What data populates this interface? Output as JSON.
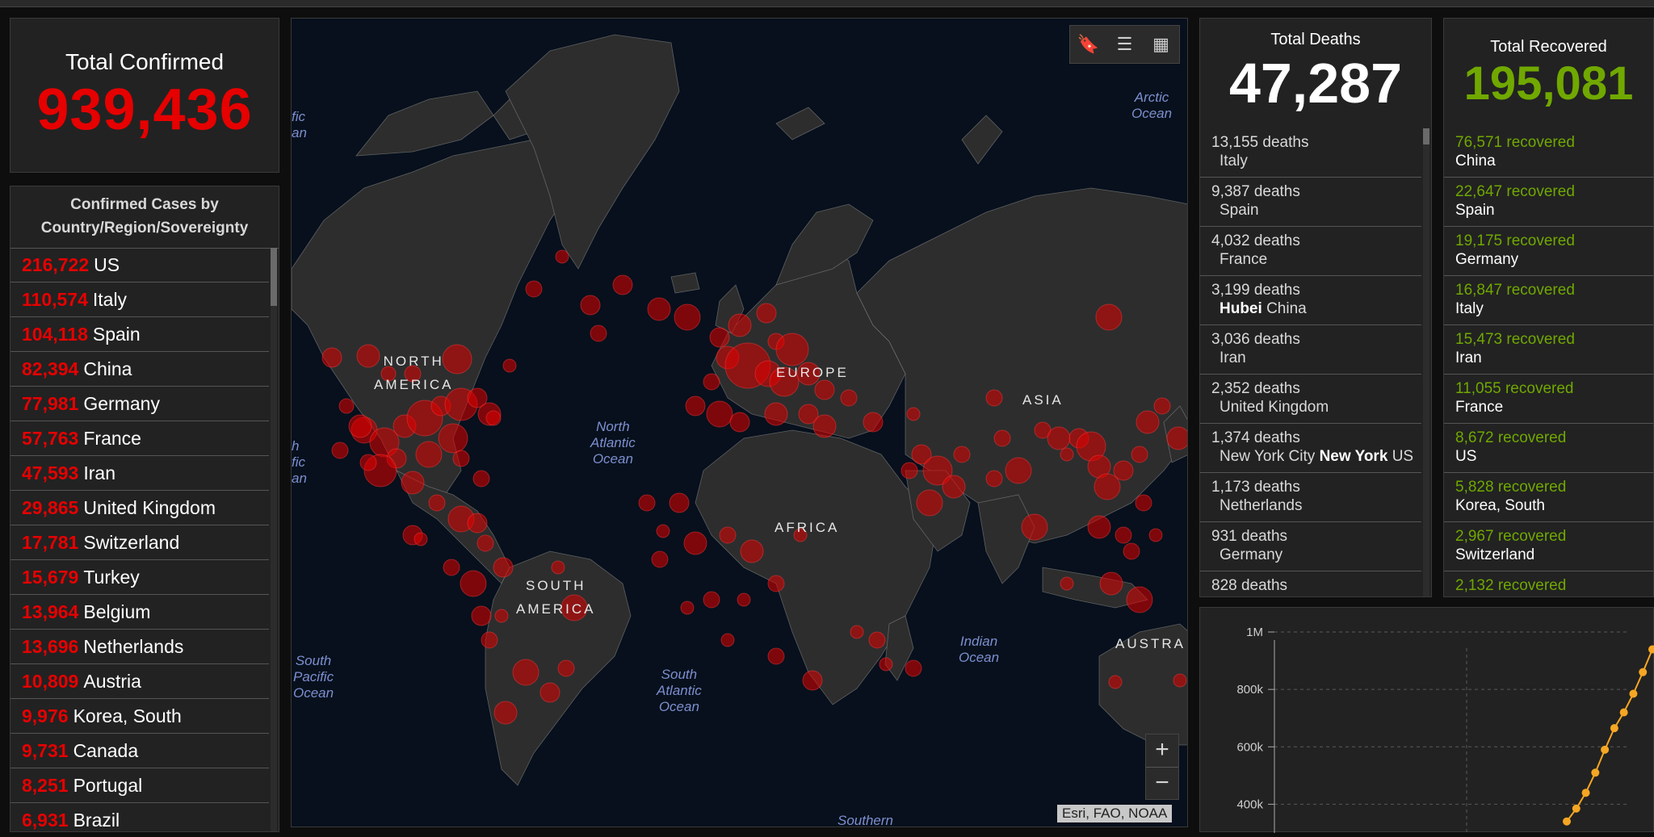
{
  "total_confirmed": {
    "title": "Total Confirmed",
    "value": "939,436"
  },
  "confirmed_list": {
    "title": "Confirmed Cases by Country/Region/Sovereignty",
    "rows": [
      {
        "count": "216,722",
        "place": "US"
      },
      {
        "count": "110,574",
        "place": "Italy"
      },
      {
        "count": "104,118",
        "place": "Spain"
      },
      {
        "count": "82,394",
        "place": "China"
      },
      {
        "count": "77,981",
        "place": "Germany"
      },
      {
        "count": "57,763",
        "place": "France"
      },
      {
        "count": "47,593",
        "place": "Iran"
      },
      {
        "count": "29,865",
        "place": "United Kingdom"
      },
      {
        "count": "17,781",
        "place": "Switzerland"
      },
      {
        "count": "15,679",
        "place": "Turkey"
      },
      {
        "count": "13,964",
        "place": "Belgium"
      },
      {
        "count": "13,696",
        "place": "Netherlands"
      },
      {
        "count": "10,809",
        "place": "Austria"
      },
      {
        "count": "9,976",
        "place": "Korea, South"
      },
      {
        "count": "9,731",
        "place": "Canada"
      },
      {
        "count": "8,251",
        "place": "Portugal"
      },
      {
        "count": "6,931",
        "place": "Brazil"
      }
    ]
  },
  "map": {
    "tools": {
      "bookmark_icon": "bookmark-icon",
      "list_icon": "list-icon",
      "grid_icon": "basemap-gallery-icon"
    },
    "zoom_in": "+",
    "zoom_out": "−",
    "attribution": "Esri, FAO, NOAA",
    "region_labels": {
      "north_america": "NORTH\nAMERICA",
      "europe": "EUROPE",
      "asia": "ASIA",
      "africa": "AFRICA",
      "south_america": "SOUTH\nAMERICA",
      "australia": "AUSTRA"
    },
    "ocean_labels": {
      "arctic": "Arctic\nOcean",
      "north_atlantic": "North\nAtlantic\nOcean",
      "south_atlantic": "South\nAtlantic\nOcean",
      "indian": "Indian\nOcean",
      "south_pacific": "South\nPacific\nOcean",
      "southern": "Southern",
      "pacific_fragment_top": "fic\nan",
      "pacific_fragment_mid": "h\nfic\nan"
    },
    "accent_color": "#e60000"
  },
  "total_deaths": {
    "title": "Total Deaths",
    "value": "47,287",
    "rows": [
      {
        "count": "13,155 deaths",
        "bold": "",
        "place": "Italy"
      },
      {
        "count": "9,387 deaths",
        "bold": "",
        "place": "Spain"
      },
      {
        "count": "4,032 deaths",
        "bold": "",
        "place": "France"
      },
      {
        "count": "3,199 deaths",
        "bold": "Hubei",
        "place": "China"
      },
      {
        "count": "3,036 deaths",
        "bold": "",
        "place": "Iran"
      },
      {
        "count": "2,352 deaths",
        "bold": "",
        "place": "United Kingdom"
      },
      {
        "count": "1,374 deaths",
        "pre": "New York City",
        "bold": "New York",
        "place": "US"
      },
      {
        "count": "1,173 deaths",
        "bold": "",
        "place": "Netherlands"
      },
      {
        "count": "931 deaths",
        "bold": "",
        "place": "Germany"
      },
      {
        "count": "828 deaths",
        "bold": "",
        "place": ""
      }
    ]
  },
  "total_recovered": {
    "title": "Total Recovered",
    "value": "195,081",
    "rows": [
      {
        "count": "76,571 recovered",
        "place": "China"
      },
      {
        "count": "22,647 recovered",
        "place": "Spain"
      },
      {
        "count": "19,175 recovered",
        "place": "Germany"
      },
      {
        "count": "16,847 recovered",
        "place": "Italy"
      },
      {
        "count": "15,473 recovered",
        "place": "Iran"
      },
      {
        "count": "11,055 recovered",
        "place": "France"
      },
      {
        "count": "8,672 recovered",
        "place": "US"
      },
      {
        "count": "5,828 recovered",
        "place": "Korea, South"
      },
      {
        "count": "2,967 recovered",
        "place": "Switzerland"
      },
      {
        "count": "2,132 recovered",
        "place": ""
      }
    ]
  },
  "chart_data": {
    "type": "line",
    "title": "",
    "xlabel": "",
    "ylabel": "",
    "yticks": [
      "1M",
      "800k",
      "600k",
      "400k"
    ],
    "ylim": [
      300000,
      1000000
    ],
    "series": [
      {
        "values": [
          340000,
          385000,
          440000,
          510000,
          590000,
          665000,
          720000,
          785000,
          860000,
          939436
        ],
        "color": "#f5a623"
      }
    ],
    "grid": true
  }
}
